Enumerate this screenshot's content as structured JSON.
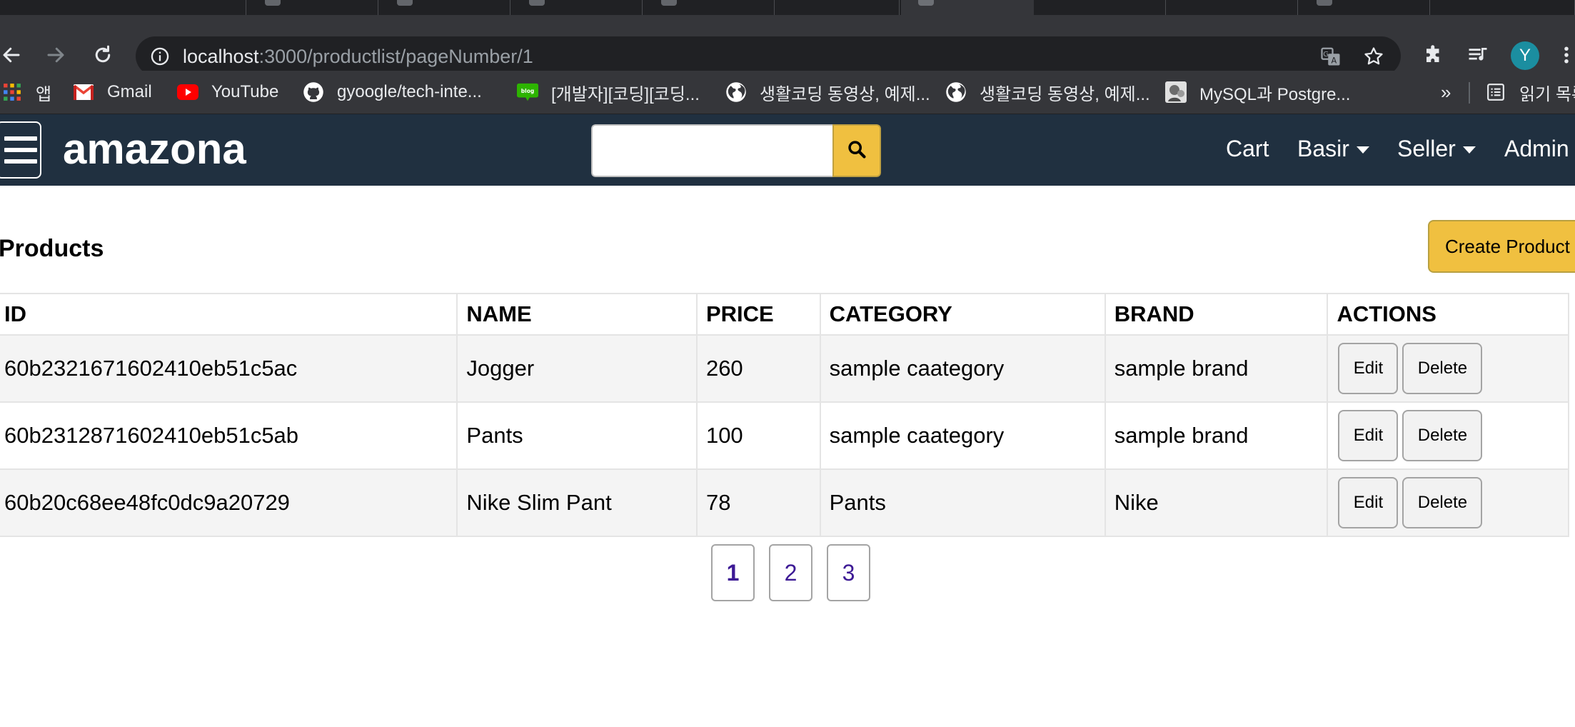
{
  "browser": {
    "url_host": "localhost",
    "url_path": ":3000/productlist/pageNumber/1",
    "profile_initial": "Y",
    "bookmarks": [
      {
        "label": "앱",
        "icon": "apps-grid-icon"
      },
      {
        "label": "Gmail",
        "icon": "gmail-icon"
      },
      {
        "label": "YouTube",
        "icon": "youtube-icon"
      },
      {
        "label": "gyoogle/tech-inte...",
        "icon": "github-icon"
      },
      {
        "label": "[개발자][코딩][코딩...",
        "icon": "blog-icon"
      },
      {
        "label": "생활코딩 동영상, 예제...",
        "icon": "globe-icon"
      },
      {
        "label": "생활코딩 동영상, 예제...",
        "icon": "globe-icon"
      },
      {
        "label": "MySQL과 Postgre...",
        "icon": "site-thumbnail-icon"
      }
    ],
    "bookmarks_overflow": "»",
    "reading_list": "읽기 목록"
  },
  "header": {
    "brand": "amazona",
    "search_placeholder": "",
    "nav": {
      "cart": "Cart",
      "user": "Basir",
      "seller": "Seller",
      "admin": "Admin"
    }
  },
  "main": {
    "title": "Products",
    "create_button": "Create Product",
    "columns": [
      "ID",
      "NAME",
      "PRICE",
      "CATEGORY",
      "BRAND",
      "ACTIONS"
    ],
    "rows": [
      {
        "id": "60b2321671602410eb51c5ac",
        "name": "Jogger",
        "price": "260",
        "category": "sample caategory",
        "brand": "sample brand"
      },
      {
        "id": "60b2312871602410eb51c5ab",
        "name": "Pants",
        "price": "100",
        "category": "sample caategory",
        "brand": "sample brand"
      },
      {
        "id": "60b20c68ee48fc0dc9a20729",
        "name": "Nike Slim Pant",
        "price": "78",
        "category": "Pants",
        "brand": "Nike"
      }
    ],
    "edit_label": "Edit",
    "delete_label": "Delete",
    "pages": [
      "1",
      "2",
      "3"
    ],
    "current_page": "1"
  },
  "colors": {
    "header_bg": "#203040",
    "accent": "#f0c040",
    "page_link": "#3d1a95",
    "browser_chrome": "#35363a",
    "avatar": "#1b8ea0"
  }
}
